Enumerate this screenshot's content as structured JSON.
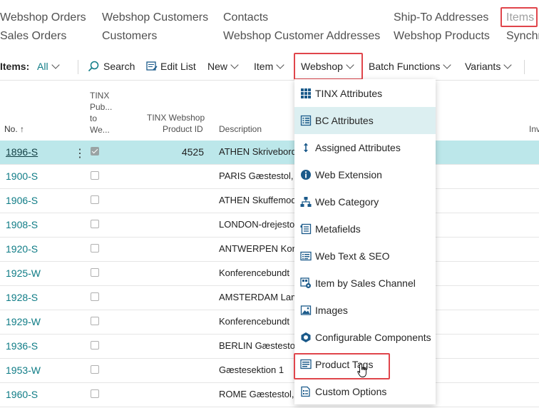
{
  "nav": {
    "row1": [
      {
        "label": "Webshop Orders"
      },
      {
        "label": "Webshop Customers"
      },
      {
        "label": "Contacts"
      },
      {
        "label": "Ship-To Addresses"
      },
      {
        "label": "Items"
      }
    ],
    "row2": [
      {
        "label": "Sales Orders"
      },
      {
        "label": "Customers"
      },
      {
        "label": "Webshop Customer Addresses"
      },
      {
        "label": "Webshop Products"
      },
      {
        "label": "Synchr"
      }
    ]
  },
  "actionbar": {
    "items_label": "Items:",
    "filter_value": "All",
    "search": "Search",
    "edit_list": "Edit List",
    "new": "New",
    "item": "Item",
    "webshop": "Webshop",
    "batch": "Batch Functions",
    "variants": "Variants"
  },
  "columns": {
    "no": "No. ↑",
    "pub_1": "TINX",
    "pub_2": "Pub...",
    "pub_3": "to",
    "pub_4": "We...",
    "pid_1": "TINX Webshop",
    "pid_2": "Product ID",
    "desc": "Description",
    "inv": "Inv"
  },
  "rows": [
    {
      "no": "1896-S",
      "checked": true,
      "pid": "4525",
      "desc": "ATHEN Skrivebord"
    },
    {
      "no": "1900-S",
      "checked": false,
      "pid": "",
      "desc": "PARIS Gæstestol,"
    },
    {
      "no": "1906-S",
      "checked": false,
      "pid": "",
      "desc": "ATHEN Skuffemod"
    },
    {
      "no": "1908-S",
      "checked": false,
      "pid": "",
      "desc": "LONDON-drejestol"
    },
    {
      "no": "1920-S",
      "checked": false,
      "pid": "",
      "desc": "ANTWERPEN Konf"
    },
    {
      "no": "1925-W",
      "checked": false,
      "pid": "",
      "desc": "Konferencebundt"
    },
    {
      "no": "1928-S",
      "checked": false,
      "pid": "",
      "desc": "AMSTERDAM Lamp"
    },
    {
      "no": "1929-W",
      "checked": false,
      "pid": "",
      "desc": "Konferencebundt"
    },
    {
      "no": "1936-S",
      "checked": false,
      "pid": "",
      "desc": "BERLIN Gæstestol"
    },
    {
      "no": "1953-W",
      "checked": false,
      "pid": "",
      "desc": "Gæstesektion 1"
    },
    {
      "no": "1960-S",
      "checked": false,
      "pid": "",
      "desc": "ROME Gæstestol,"
    }
  ],
  "menu": [
    {
      "label": "TINX Attributes",
      "icon": "grid-icon"
    },
    {
      "label": "BC Attributes",
      "icon": "list-icon"
    },
    {
      "label": "Assigned Attributes",
      "icon": "sort-arrows-icon"
    },
    {
      "label": "Web Extension",
      "icon": "info-icon"
    },
    {
      "label": "Web Category",
      "icon": "hierarchy-icon"
    },
    {
      "label": "Metafields",
      "icon": "tag-list-icon"
    },
    {
      "label": "Web Text & SEO",
      "icon": "text-icon"
    },
    {
      "label": "Item by Sales Channel",
      "icon": "channel-icon"
    },
    {
      "label": "Images",
      "icon": "image-icon"
    },
    {
      "label": "Configurable Components",
      "icon": "hexagon-icon"
    },
    {
      "label": "Product Tags",
      "icon": "tags-icon"
    },
    {
      "label": "Custom Options",
      "icon": "options-icon"
    }
  ],
  "colors": {
    "accent": "#0f7c86",
    "selected_row": "#bce7ea",
    "highlight_box": "#e0454b",
    "icon": "#1b5a8a"
  }
}
